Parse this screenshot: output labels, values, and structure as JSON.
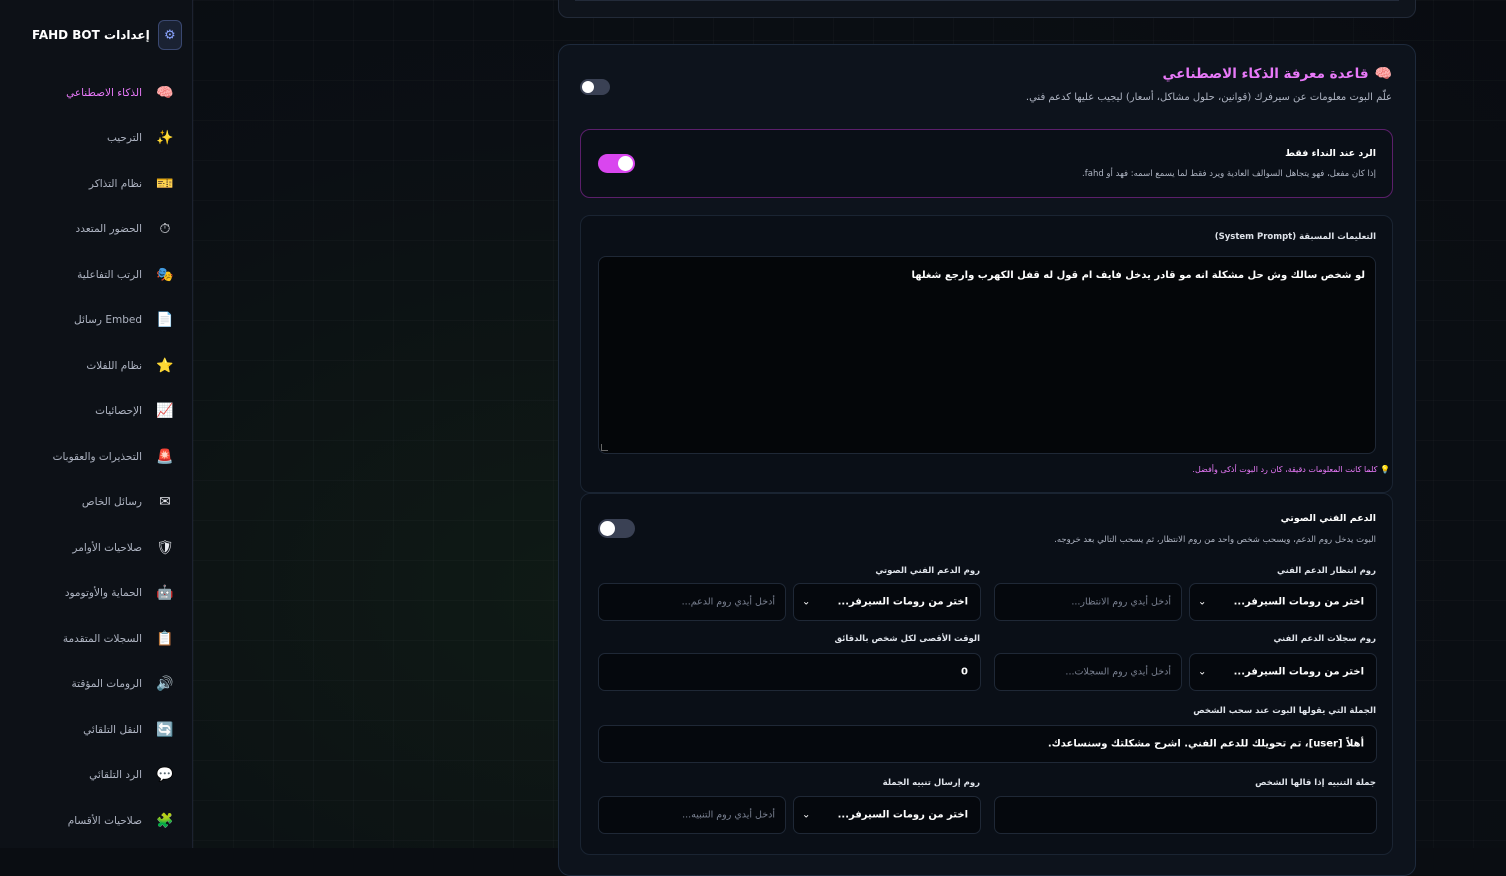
{
  "brand": {
    "title": "إعدادات",
    "name": "FAHD BOT"
  },
  "sidebar": {
    "items": [
      {
        "label": "الذكاء الاصطناعي",
        "icon": "brain-icon",
        "glyph": "🧠",
        "active": true
      },
      {
        "label": "الترحيب",
        "icon": "sparkles-icon",
        "glyph": "✨"
      },
      {
        "label": "نظام التذاكر",
        "icon": "ticket-icon",
        "glyph": "🎫"
      },
      {
        "label": "الحضور المتعدد",
        "icon": "stopwatch-icon",
        "glyph": "⏱"
      },
      {
        "label": "الرتب التفاعلية",
        "icon": "masks-icon",
        "glyph": "🎭"
      },
      {
        "label": "رسائل Embed",
        "icon": "document-icon",
        "glyph": "📄"
      },
      {
        "label": "نظام اللفلات",
        "icon": "star-icon",
        "glyph": "⭐"
      },
      {
        "label": "الإحصائيات",
        "icon": "chart-icon",
        "glyph": "📈"
      },
      {
        "label": "التحذيرات والعقوبات",
        "icon": "siren-icon",
        "glyph": "🚨"
      },
      {
        "label": "رسائل الخاص",
        "icon": "envelope-icon",
        "glyph": "✉"
      },
      {
        "label": "صلاحيات الأوامر",
        "icon": "shield-icon",
        "glyph": "🛡"
      },
      {
        "label": "الحماية والأوتومود",
        "icon": "robot-icon",
        "glyph": "🤖"
      },
      {
        "label": "السجلات المتقدمة",
        "icon": "clipboard-icon",
        "glyph": "📋"
      },
      {
        "label": "الرومات المؤقتة",
        "icon": "speaker-icon",
        "glyph": "🔊"
      },
      {
        "label": "النقل التلقائي",
        "icon": "refresh-icon",
        "glyph": "🔄"
      },
      {
        "label": "الرد التلقائي",
        "icon": "speech-bubble-icon",
        "glyph": "💬"
      },
      {
        "label": "صلاحيات الأقسام",
        "icon": "puzzle-icon",
        "glyph": "🧩"
      }
    ]
  },
  "ai": {
    "title": "قاعدة معرفة الذكاء الاصطناعي",
    "subtitle": "علّم البوت معلومات عن سيرفرك (قوانين، حلول مشاكل، أسعار) ليجيب عليها كدعم فني.",
    "enabled": false,
    "call_only": {
      "title": "الرد عند النداء فقط",
      "desc": "إذا كان مفعل، فهو يتجاهل السوالف العادية ويرد فقط لما يسمع اسمه: فهد أو fahd.",
      "enabled": true
    },
    "prompt": {
      "label": "التعليمات المسبقة (System Prompt)",
      "value": "لو شخص سالك وش حل مشكلة انه مو قادر يدخل فايف ام قول له قفل الكهرب وارجع شغلها",
      "hint": "💡 كلما كانت المعلومات دقيقة، كان رد البوت أذكى وأفضل."
    }
  },
  "voice": {
    "title": "الدعم الفني الصوتي",
    "desc": "البوت يدخل روم الدعم، ويسحب شخص واحد من روم الانتظار، ثم يسحب التالي بعد خروجه.",
    "enabled": false,
    "select_placeholder": "اختر من رومات السيرفر...",
    "waiting": {
      "label": "روم انتظار الدعم الفني",
      "placeholder": "أدخل أيدي روم الانتظار..."
    },
    "support": {
      "label": "روم الدعم الفني الصوتي",
      "placeholder": "أدخل أيدي روم الدعم..."
    },
    "logs": {
      "label": "روم سجلات الدعم الفني",
      "placeholder": "أدخل أيدي روم السجلات..."
    },
    "max_time": {
      "label": "الوقت الأقصى لكل شخص بالدقائق",
      "value": "0"
    },
    "pull_message": {
      "label": "الجملة التي يقولها البوت عند سحب الشخص",
      "value": "أهلاً [user]، تم تحويلك للدعم الفني. اشرح مشكلتك وسنساعدك."
    },
    "alert_phrase": {
      "label": "جملة التنبيه إذا قالها الشخص",
      "value": ""
    },
    "alert_room": {
      "label": "روم إرسال تنبيه الجملة",
      "placeholder": "أدخل أيدي روم التنبيه..."
    }
  },
  "colors": {
    "accent": "#e879f9",
    "toggle_on": "#d946ef",
    "toggle_off": "#3a4154",
    "background": "#0a0d12"
  }
}
